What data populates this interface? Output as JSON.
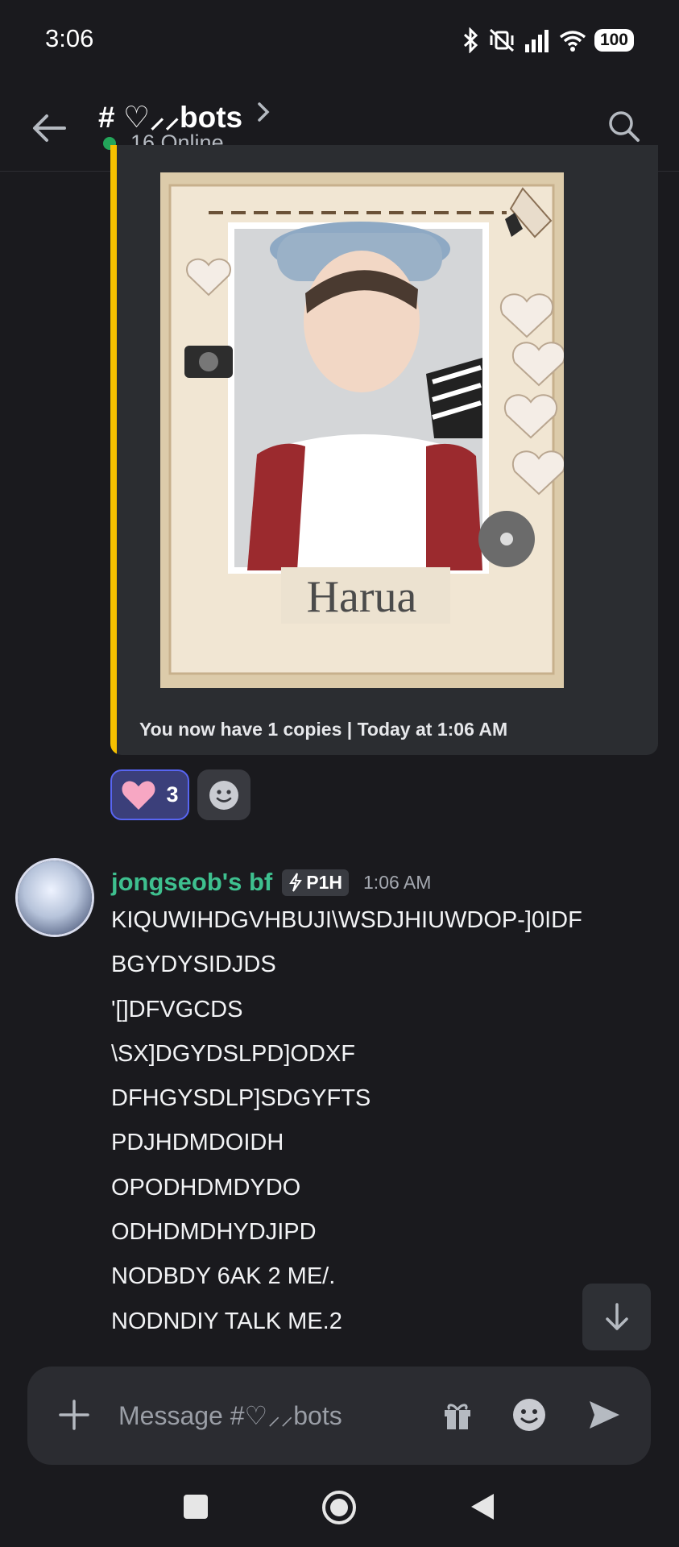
{
  "status_bar": {
    "time": "3:06",
    "battery": "100"
  },
  "header": {
    "channel_name": "# ♡⸝⸝bots",
    "online_text": "16 Online"
  },
  "embed": {
    "image_caption": "Harua",
    "footer_text": "You now have 1 copies | Today at 1:06 AM",
    "accent_color": "#f5c000"
  },
  "reactions": [
    {
      "emoji": "heart",
      "count": "3"
    }
  ],
  "message": {
    "author": "jongseob's bf",
    "tag": "P1H",
    "time": "1:06 AM",
    "author_color": "#3ec08f",
    "lines": [
      "KIQUWIHDGVHBUJI\\WSDJHIUWDOP-]0IDF",
      "BGYDYSIDJDS",
      "'[]DFVGCDS",
      "\\SX]DGYDSLPD]ODXF",
      "DFHGYSDLP]SDGYFTS",
      "PDJHDMDOIDH",
      "OPODHDMDYDO",
      "ODHDMDHYDJIPD",
      "NODBDY 6AK 2 ME/.",
      "NODNDIY TALK ME.2"
    ]
  },
  "composer": {
    "placeholder": "Message #♡⸝⸝bots"
  }
}
